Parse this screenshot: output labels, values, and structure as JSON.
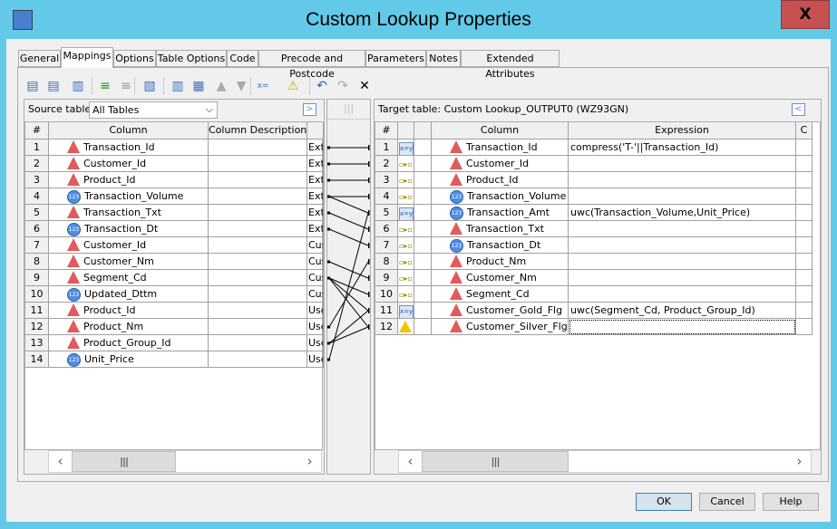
{
  "window": {
    "title": "Custom Lookup Properties",
    "close_label": "X"
  },
  "tabs": [
    {
      "label": "General"
    },
    {
      "label": "Mappings",
      "selected": true
    },
    {
      "label": "Options"
    },
    {
      "label": "Table Options"
    },
    {
      "label": "Code"
    },
    {
      "label": "Precode and Postcode"
    },
    {
      "label": "Parameters"
    },
    {
      "label": "Notes"
    },
    {
      "label": "Extended Attributes"
    }
  ],
  "toolbar": [
    "import-columns-icon",
    "export-columns-icon",
    "copy-columns-icon",
    "map-all-icon",
    "unmap-all-icon",
    "properties-icon",
    "new-column-icon",
    "propagate-icon",
    "move-up-icon",
    "move-down-icon",
    "expression-icon",
    "warning-icon",
    "undo-icon",
    "redo-icon",
    "delete-icon"
  ],
  "source": {
    "label": "Source table:",
    "selected": "All Tables",
    "headers": [
      "#",
      "Column",
      "Column Description",
      ""
    ],
    "rows": [
      {
        "n": "1",
        "type": "char",
        "name": "Transaction_Id",
        "desc": "",
        "extra": "Ext"
      },
      {
        "n": "2",
        "type": "char",
        "name": "Customer_Id",
        "desc": "",
        "extra": "Ext"
      },
      {
        "n": "3",
        "type": "char",
        "name": "Product_Id",
        "desc": "",
        "extra": "Ext"
      },
      {
        "n": "4",
        "type": "num",
        "name": "Transaction_Volume",
        "desc": "",
        "extra": "Ext"
      },
      {
        "n": "5",
        "type": "char",
        "name": "Transaction_Txt",
        "desc": "",
        "extra": "Ext"
      },
      {
        "n": "6",
        "type": "num",
        "name": "Transaction_Dt",
        "desc": "",
        "extra": "Ext"
      },
      {
        "n": "7",
        "type": "char",
        "name": "Customer_Id",
        "desc": "",
        "extra": "Cus"
      },
      {
        "n": "8",
        "type": "char",
        "name": "Customer_Nm",
        "desc": "",
        "extra": "Cus"
      },
      {
        "n": "9",
        "type": "char",
        "name": "Segment_Cd",
        "desc": "",
        "extra": "Cus"
      },
      {
        "n": "10",
        "type": "num",
        "name": "Updated_Dttm",
        "desc": "",
        "extra": "Cus"
      },
      {
        "n": "11",
        "type": "char",
        "name": "Product_Id",
        "desc": "",
        "extra": "Use"
      },
      {
        "n": "12",
        "type": "char",
        "name": "Product_Nm",
        "desc": "",
        "extra": "Use"
      },
      {
        "n": "13",
        "type": "char",
        "name": "Product_Group_Id",
        "desc": "",
        "extra": "Use"
      },
      {
        "n": "14",
        "type": "num",
        "name": "Unit_Price",
        "desc": "",
        "extra": "Use"
      }
    ]
  },
  "mappings": [
    [
      1,
      1
    ],
    [
      2,
      2
    ],
    [
      3,
      3
    ],
    [
      4,
      4
    ],
    [
      4,
      5
    ],
    [
      5,
      6
    ],
    [
      6,
      7
    ],
    [
      8,
      9
    ],
    [
      9,
      10
    ],
    [
      9,
      11
    ],
    [
      9,
      12
    ],
    [
      12,
      8
    ],
    [
      13,
      11
    ],
    [
      13,
      12
    ],
    [
      14,
      5
    ]
  ],
  "target": {
    "label": "Target table: Custom Lookup_OUTPUT0 (WZ93GN)",
    "headers": [
      "#",
      "",
      "",
      "Column",
      "Expression",
      "C"
    ],
    "rows": [
      {
        "n": "1",
        "map": "expression",
        "type": "char",
        "name": "Transaction_Id",
        "expr": "compress('T-'||Transaction_Id)"
      },
      {
        "n": "2",
        "map": "direct",
        "type": "char",
        "name": "Customer_Id",
        "expr": ""
      },
      {
        "n": "3",
        "map": "direct",
        "type": "char",
        "name": "Product_Id",
        "expr": ""
      },
      {
        "n": "4",
        "map": "direct",
        "type": "num",
        "name": "Transaction_Volume",
        "expr": ""
      },
      {
        "n": "5",
        "map": "expression",
        "type": "num",
        "name": "Transaction_Amt",
        "expr": "uwc(Transaction_Volume,Unit_Price)"
      },
      {
        "n": "6",
        "map": "direct",
        "type": "char",
        "name": "Transaction_Txt",
        "expr": ""
      },
      {
        "n": "7",
        "map": "direct",
        "type": "num",
        "name": "Transaction_Dt",
        "expr": ""
      },
      {
        "n": "8",
        "map": "direct",
        "type": "char",
        "name": "Product_Nm",
        "expr": ""
      },
      {
        "n": "9",
        "map": "direct",
        "type": "char",
        "name": "Customer_Nm",
        "expr": ""
      },
      {
        "n": "10",
        "map": "direct",
        "type": "char",
        "name": "Segment_Cd",
        "expr": ""
      },
      {
        "n": "11",
        "map": "expression",
        "type": "char",
        "name": "Customer_Gold_Flg",
        "expr": "uwc(Segment_Cd, Product_Group_Id)"
      },
      {
        "n": "12",
        "map": "warning",
        "type": "char",
        "name": "Customer_Silver_Flg",
        "expr": ""
      }
    ]
  },
  "buttons": {
    "ok": "OK",
    "cancel": "Cancel",
    "help": "Help"
  },
  "colors": {
    "titlebar": "#63c9e8",
    "close": "#c75050",
    "char_icon": "#e35a5a",
    "num_icon": "#4f8ee0"
  }
}
